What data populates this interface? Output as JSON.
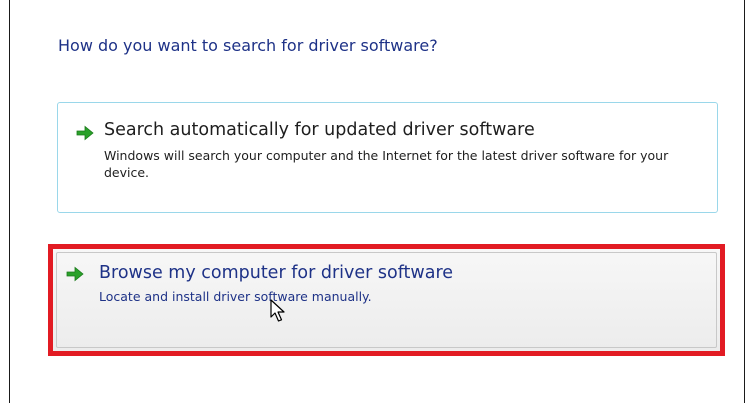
{
  "heading": "How do you want to search for driver software?",
  "options": [
    {
      "title": "Search automatically for updated driver software",
      "description": "Windows will search your computer and the Internet for the latest driver software for your device."
    },
    {
      "title": "Browse my computer for driver software",
      "description": "Locate and install driver software manually."
    }
  ],
  "icons": {
    "option_arrow": "green-arrow-icon",
    "cursor": "mouse-pointer-icon"
  },
  "colors": {
    "link_blue": "#1e3287",
    "arrow_green": "#2aa12a",
    "highlight_red": "#e21b23",
    "option_border": "#9ad7ea"
  }
}
